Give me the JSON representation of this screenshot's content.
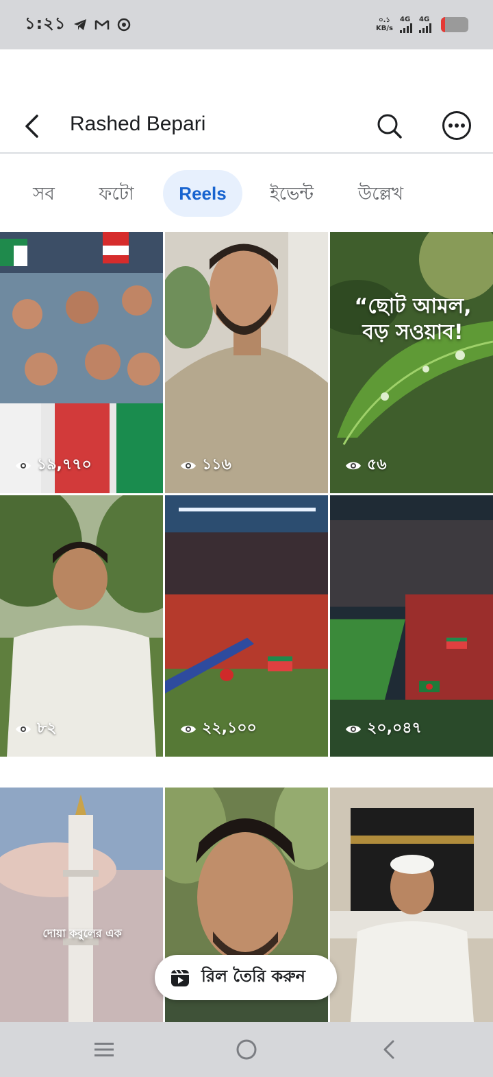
{
  "status_bar": {
    "time": "১:২১",
    "icons": [
      "telegram-icon",
      "gmail-icon",
      "chrome-icon"
    ],
    "net_speed_value": "০.১",
    "net_speed_unit": "KB/s",
    "sim1_label": "4G",
    "sim2_label": "4G",
    "battery_level": 0.15,
    "battery_color": "#e53935"
  },
  "header": {
    "back_icon": "back-arrow-icon",
    "title": "Rashed Bepari",
    "search_icon": "search-icon",
    "more_icon": "more-options-icon"
  },
  "tabs": [
    {
      "label": "সব",
      "active": false
    },
    {
      "label": "ফটো",
      "active": false
    },
    {
      "label": "Reels",
      "active": true
    },
    {
      "label": "ইভেন্ট",
      "active": false
    },
    {
      "label": "উল্লেখ",
      "active": false
    }
  ],
  "reels": [
    {
      "views": "১৯,৭৭০"
    },
    {
      "views": "১১৬"
    },
    {
      "views": "৫৬",
      "caption": "“ছোট আমল,\nবড় সওয়াব!"
    },
    {
      "views": "৮২"
    },
    {
      "views": "২২,১০০"
    },
    {
      "views": "২০,০৪৭"
    },
    {
      "views": "",
      "caption": "দোয়া কবুলের এক"
    },
    {
      "views": ""
    },
    {
      "views": ""
    }
  ],
  "create_reel": {
    "label": "রিল তৈরি করুন",
    "icon": "reel-camera-icon"
  },
  "nav_bar": {
    "icons": [
      "menu-icon",
      "home-circle-icon",
      "back-icon"
    ]
  },
  "colors": {
    "accent": "#1763cf",
    "active_tab_bg": "#e7f0fd",
    "status_bg": "#d6d7da"
  }
}
